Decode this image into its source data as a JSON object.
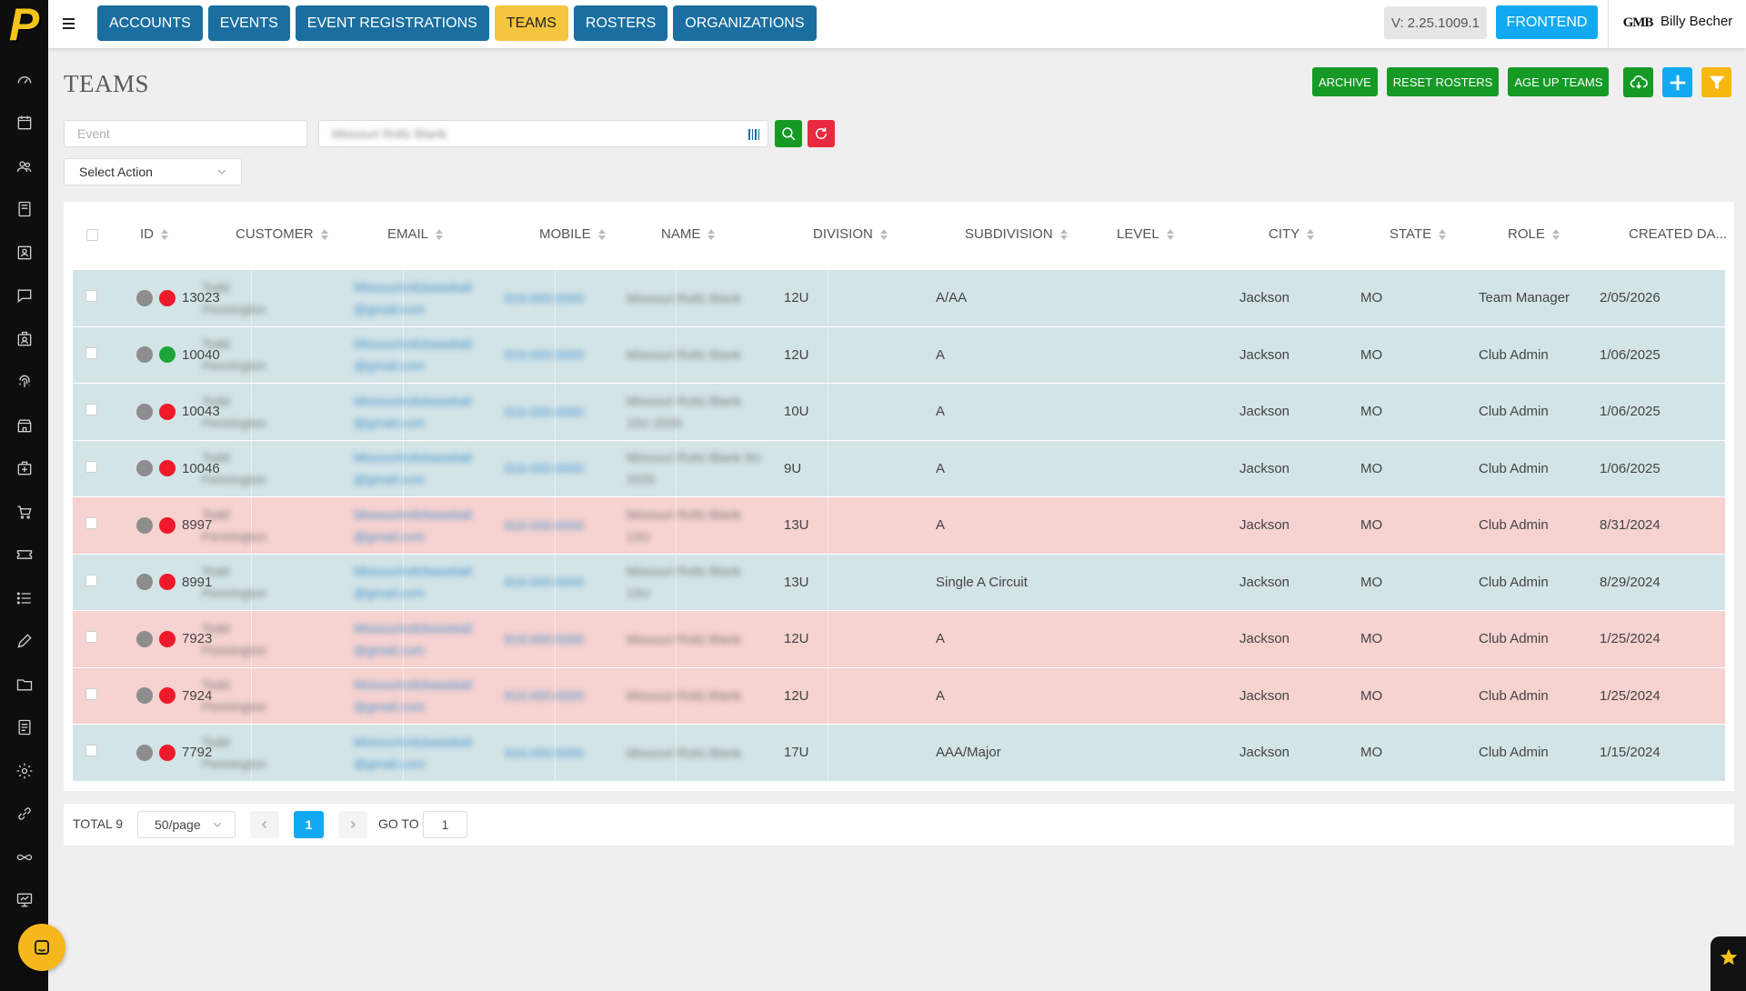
{
  "nav": {
    "items": [
      "ACCOUNTS",
      "EVENTS",
      "EVENT REGISTRATIONS",
      "TEAMS",
      "ROSTERS",
      "ORGANIZATIONS"
    ],
    "active": "TEAMS"
  },
  "header": {
    "version": "V: 2.25.1009.1",
    "frontend_label": "FRONTEND",
    "user_logo_text": "GMB",
    "user_name": "Billy Becher"
  },
  "page": {
    "title": "TEAMS",
    "actions": [
      "ARCHIVE",
      "RESET ROSTERS",
      "AGE UP TEAMS"
    ]
  },
  "filters": {
    "event_placeholder": "Event",
    "search_value": "Missouri Rollz Blank",
    "select_action": "Select Action"
  },
  "colors": {
    "nav_blue": "#1a6fa0",
    "nav_active": "#f6c53f",
    "action_green": "#169a26",
    "accent_blue": "#13a9f0",
    "reset_red": "#e8293f",
    "row_blue": "#d3e4e7",
    "row_red": "#f6d2d0"
  },
  "table": {
    "columns": [
      "ID",
      "CUSTOMER",
      "EMAIL",
      "MOBILE",
      "NAME",
      "DIVISION",
      "SUBDIVISION",
      "LEVEL",
      "CITY",
      "STATE",
      "ROLE",
      "CREATED DA..."
    ],
    "rows": [
      {
        "id": "13023",
        "status": "red",
        "customer": "Todd Pennington",
        "email": "Missourirollzbaseball @gmail.com",
        "mobile": "816-000-0000",
        "name": "Missouri Rollz Blank",
        "division": "12U",
        "subdivision": "A/AA",
        "level": "",
        "city": "Jackson",
        "state": "MO",
        "role": "Team Manager",
        "created": "2/05/2026",
        "tone": "blue"
      },
      {
        "id": "10040",
        "status": "green",
        "customer": "Todd Pennington",
        "email": "Missourirollzbaseball @gmail.com",
        "mobile": "816-000-0000",
        "name": "Missouri Rollz Blank",
        "division": "12U",
        "subdivision": "A",
        "level": "",
        "city": "Jackson",
        "state": "MO",
        "role": "Club Admin",
        "created": "1/06/2025",
        "tone": "blue"
      },
      {
        "id": "10043",
        "status": "red",
        "customer": "Todd Pennington",
        "email": "Missourirollzbaseball @gmail.com",
        "mobile": "816-000-0000",
        "name": "Missouri Rollz Blank 10U 2026",
        "division": "10U",
        "subdivision": "A",
        "level": "",
        "city": "Jackson",
        "state": "MO",
        "role": "Club Admin",
        "created": "1/06/2025",
        "tone": "blue"
      },
      {
        "id": "10046",
        "status": "red",
        "customer": "Todd Pennington",
        "email": "Missourirollzbaseball @gmail.com",
        "mobile": "816-000-0000",
        "name": "Missouri Rollz Blank 9U 2026",
        "division": "9U",
        "subdivision": "A",
        "level": "",
        "city": "Jackson",
        "state": "MO",
        "role": "Club Admin",
        "created": "1/06/2025",
        "tone": "blue"
      },
      {
        "id": "8997",
        "status": "red",
        "customer": "Todd Pennington",
        "email": "Missourirollzbaseball @gmail.com",
        "mobile": "816-000-0000",
        "name": "Missouri Rollz Blank 13U",
        "division": "13U",
        "subdivision": "A",
        "level": "",
        "city": "Jackson",
        "state": "MO",
        "role": "Club Admin",
        "created": "8/31/2024",
        "tone": "red"
      },
      {
        "id": "8991",
        "status": "red",
        "customer": "Todd Pennington",
        "email": "Missourirollzbaseball @gmail.com",
        "mobile": "816-000-0000",
        "name": "Missouri Rollz Blank 13U",
        "division": "13U",
        "subdivision": "Single A Circuit",
        "level": "",
        "city": "Jackson",
        "state": "MO",
        "role": "Club Admin",
        "created": "8/29/2024",
        "tone": "blue"
      },
      {
        "id": "7923",
        "status": "red",
        "customer": "Todd Pennington",
        "email": "Missourirollzbaseball @gmail.com",
        "mobile": "816-000-0000",
        "name": "Missouri Rollz Blank",
        "division": "12U",
        "subdivision": "A",
        "level": "",
        "city": "Jackson",
        "state": "MO",
        "role": "Club Admin",
        "created": "1/25/2024",
        "tone": "red"
      },
      {
        "id": "7924",
        "status": "red",
        "customer": "Todd Pennington",
        "email": "Missourirollzbaseball @gmail.com",
        "mobile": "816-000-0000",
        "name": "Missouri Rollz Blank",
        "division": "12U",
        "subdivision": "A",
        "level": "",
        "city": "Jackson",
        "state": "MO",
        "role": "Club Admin",
        "created": "1/25/2024",
        "tone": "red"
      },
      {
        "id": "7792",
        "status": "red",
        "customer": "Todd Pennington",
        "email": "Missourirollzbaseball @gmail.com",
        "mobile": "816-000-0000",
        "name": "Missouri Rollz Blank",
        "division": "17U",
        "subdivision": "AAA/Major",
        "level": "",
        "city": "Jackson",
        "state": "MO",
        "role": "Club Admin",
        "created": "1/15/2024",
        "tone": "blue"
      }
    ]
  },
  "pagination": {
    "total": "TOTAL 9",
    "page_size": "50/page",
    "current_page": "1",
    "goto_label": "GO TO",
    "goto_value": "1"
  },
  "sidebar": {
    "icons": [
      "dashboard-icon",
      "calendar-icon",
      "users-icon",
      "book-icon",
      "id-card-icon",
      "chat-icon",
      "badge-icon",
      "fingerprint-icon",
      "store-icon",
      "medkit-icon",
      "cart-icon",
      "ticket-icon",
      "list-icon",
      "pencil-icon",
      "folder-icon",
      "document-icon",
      "gear-icon",
      "link-icon",
      "infinity-icon",
      "presentation-icon"
    ]
  }
}
